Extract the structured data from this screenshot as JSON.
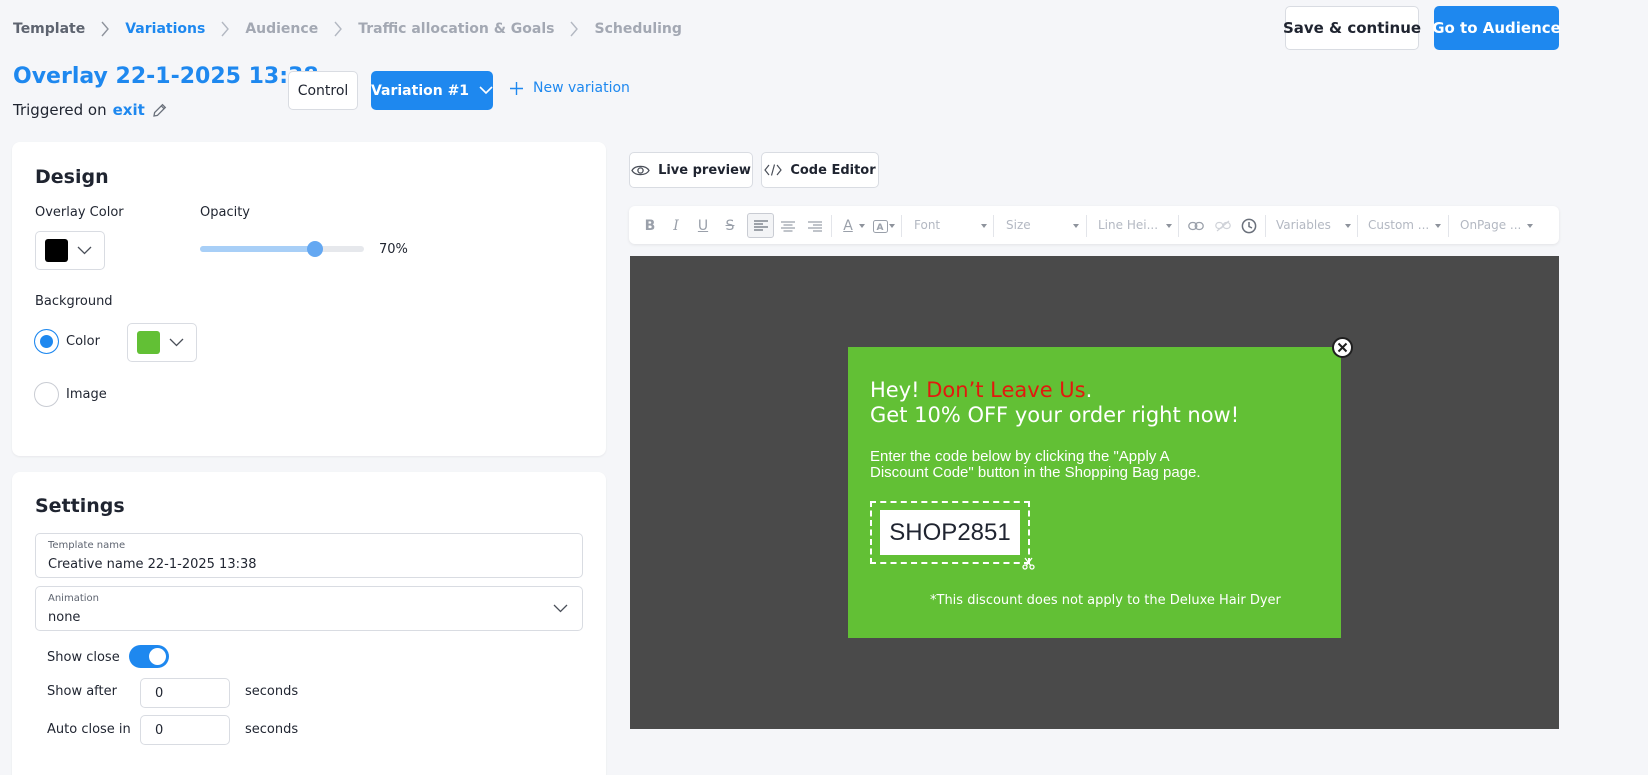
{
  "breadcrumb": [
    {
      "label": "Template",
      "state": "done"
    },
    {
      "label": "Variations",
      "state": "active"
    },
    {
      "label": "Audience",
      "state": "pending"
    },
    {
      "label": "Traffic allocation & Goals",
      "state": "pending"
    },
    {
      "label": "Scheduling",
      "state": "pending"
    }
  ],
  "header": {
    "save_label": "Save & continue",
    "go_label": "Go to Audience"
  },
  "campaign": {
    "title": "Overlay 22-1-2025 13:38",
    "triggered_prefix": "Triggered on",
    "trigger": "exit"
  },
  "variations": {
    "control_label": "Control",
    "selected_label": "Variation #1",
    "new_label": "New variation"
  },
  "design": {
    "heading": "Design",
    "overlay_color_label": "Overlay Color",
    "overlay_color": "#000000",
    "opacity_label": "Opacity",
    "opacity_value": "70%",
    "opacity_fraction": 0.7,
    "background_label": "Background",
    "bg_color": "#62c035",
    "bg_option_color": "Color",
    "bg_option_image": "Image",
    "bg_selected": "color"
  },
  "settings": {
    "heading": "Settings",
    "template_name_label": "Template name",
    "template_name_value": "Creative name 22-1-2025 13:38",
    "animation_label": "Animation",
    "animation_value": "none",
    "show_close_label": "Show close",
    "show_close": true,
    "show_after_label": "Show after",
    "show_after_value": "0",
    "auto_close_label": "Auto close in",
    "auto_close_value": "0",
    "seconds_label": "seconds"
  },
  "editor": {
    "live_preview_label": "Live preview",
    "code_editor_label": "Code Editor",
    "toolbar": {
      "font": "Font",
      "size": "Size",
      "line_height": "Line Hei...",
      "variables": "Variables",
      "custom": "Custom ...",
      "onpage": "OnPage ..."
    }
  },
  "preview": {
    "headline_part1": "Hey! ",
    "headline_highlight": "Don’t Leave Us",
    "headline_dot": ".",
    "headline_line2": "Get 10% OFF your order right now!",
    "body": "Enter the code below by clicking the \"Apply A Discount Code\" button in the Shopping Bag page.",
    "code": "SHOP2851",
    "note": "*This discount does not apply to the Deluxe Hair Dyer",
    "highlight_color": "#e11a0e",
    "canvas_color": "#4a4a4a"
  }
}
